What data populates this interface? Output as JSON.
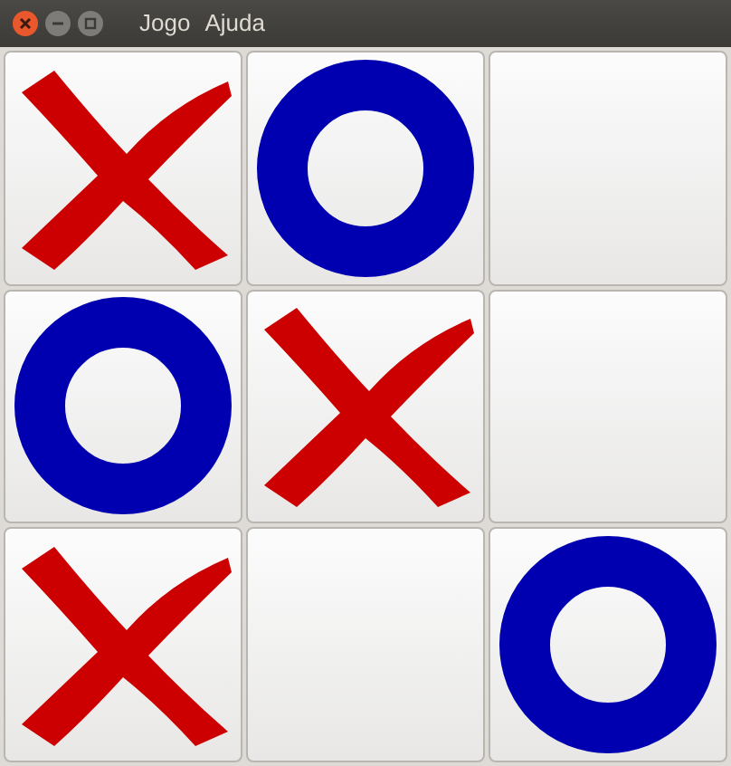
{
  "menu": [
    "Jogo",
    "Ajuda"
  ],
  "board": [
    {
      "kind": "x"
    },
    {
      "kind": "o"
    },
    {
      "kind": "empty"
    },
    {
      "kind": "o"
    },
    {
      "kind": "x"
    },
    {
      "kind": "empty"
    },
    {
      "kind": "x"
    },
    {
      "kind": "empty"
    },
    {
      "kind": "o"
    }
  ]
}
